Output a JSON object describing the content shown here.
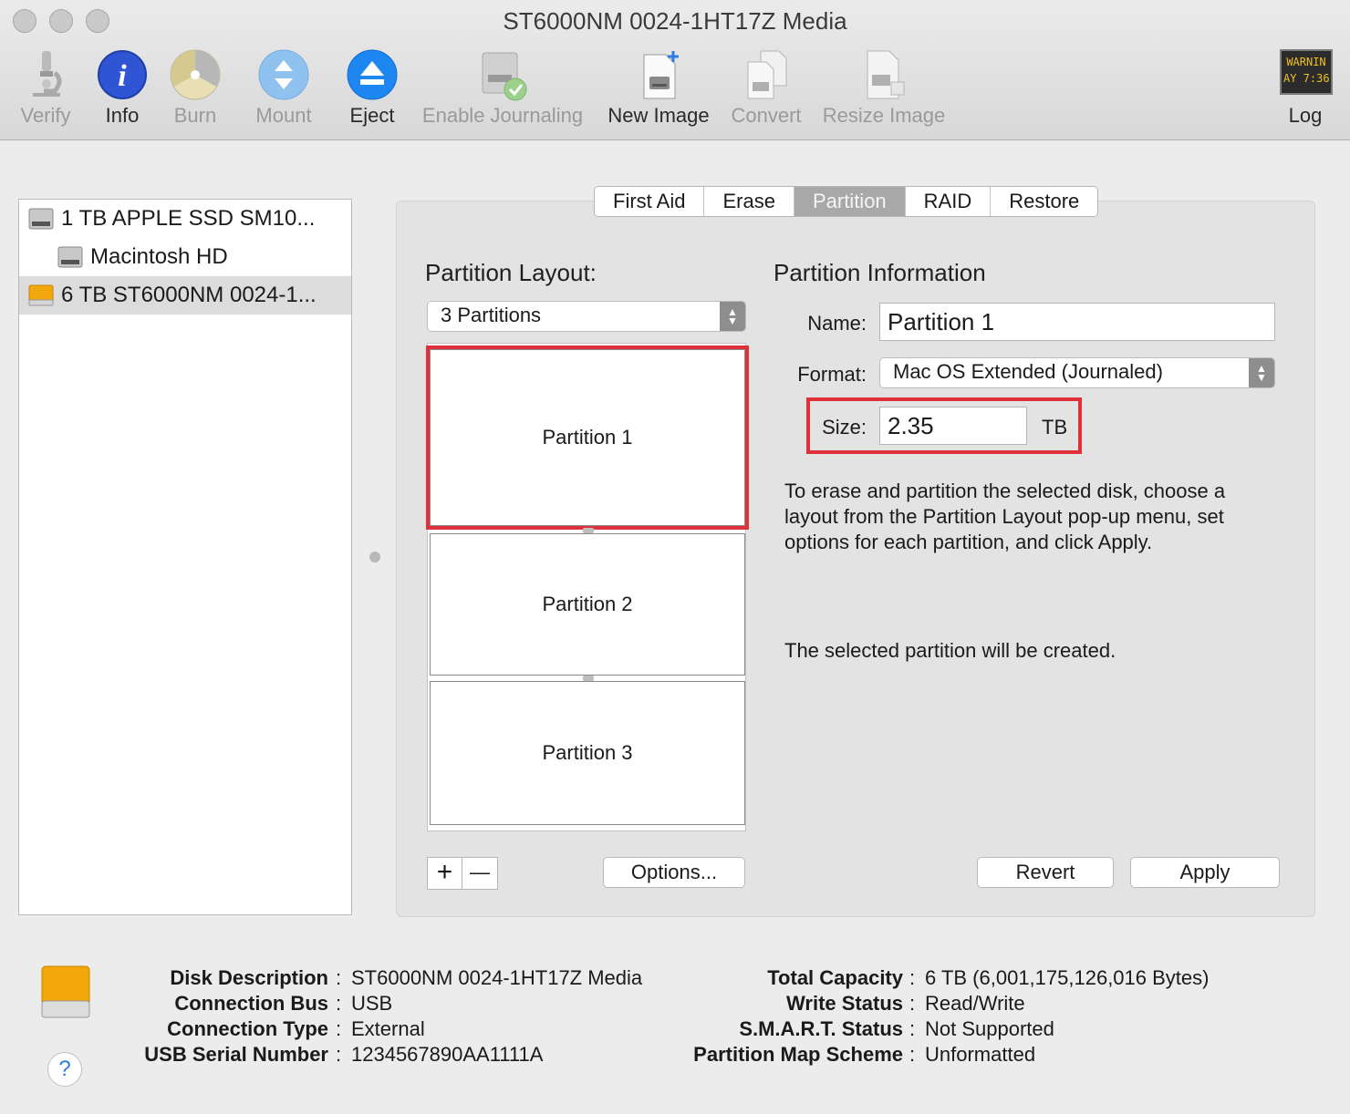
{
  "window": {
    "title": "ST6000NM 0024-1HT17Z Media"
  },
  "toolbar": {
    "verify": "Verify",
    "info": "Info",
    "burn": "Burn",
    "mount": "Mount",
    "eject": "Eject",
    "enable_journaling": "Enable Journaling",
    "new_image": "New Image",
    "convert": "Convert",
    "resize_image": "Resize Image",
    "log": "Log",
    "log_screen_line1": "WARNIN",
    "log_screen_line2": "AY 7:36"
  },
  "sidebar": {
    "items": [
      {
        "label": "1 TB APPLE SSD SM10..."
      },
      {
        "label": "Macintosh HD"
      },
      {
        "label": "6 TB ST6000NM 0024-1..."
      }
    ]
  },
  "tabs": [
    "First Aid",
    "Erase",
    "Partition",
    "RAID",
    "Restore"
  ],
  "partition": {
    "layout_title": "Partition Layout:",
    "layout_value": "3 Partitions",
    "partitions": [
      "Partition 1",
      "Partition 2",
      "Partition 3"
    ],
    "info_title": "Partition Information",
    "name_label": "Name:",
    "name_value": "Partition 1",
    "format_label": "Format:",
    "format_value": "Mac OS Extended (Journaled)",
    "size_label": "Size:",
    "size_value": "2.35",
    "size_unit": "TB",
    "help_line1": "To erase and partition the selected disk, choose a",
    "help_line2": "layout from the Partition Layout pop-up menu, set",
    "help_line3": "options for each partition, and click Apply.",
    "status_text": "The selected partition will be created.",
    "add": "+",
    "remove": "—",
    "options_button": "Options...",
    "revert_button": "Revert",
    "apply_button": "Apply"
  },
  "disk_info": {
    "left": [
      {
        "key": "Disk Description",
        "value": "ST6000NM 0024-1HT17Z Media"
      },
      {
        "key": "Connection Bus",
        "value": "USB"
      },
      {
        "key": "Connection Type",
        "value": "External"
      },
      {
        "key": "USB Serial Number",
        "value": "1234567890AA1111A"
      }
    ],
    "right": [
      {
        "key": "Total Capacity",
        "value": "6 TB (6,001,175,126,016 Bytes)"
      },
      {
        "key": "Write Status",
        "value": "Read/Write"
      },
      {
        "key": "S.M.A.R.T. Status",
        "value": "Not Supported"
      },
      {
        "key": "Partition Map Scheme",
        "value": "Unformatted"
      }
    ],
    "separator": ":",
    "help": "?"
  },
  "colors": {
    "selection_highlight": "#e0303a",
    "info_icon": "#2f55d4",
    "eject_icon": "#1e86f0",
    "external_drive": "#f2a80c"
  }
}
